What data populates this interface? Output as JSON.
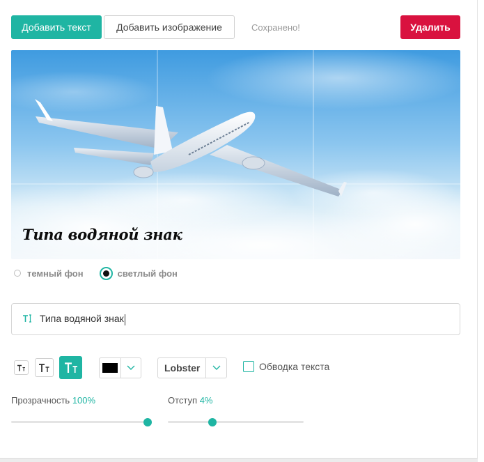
{
  "toolbar": {
    "add_text_label": "Добавить текст",
    "add_image_label": "Добавить изображение",
    "status": "Сохранено!",
    "delete_label": "Удалить"
  },
  "canvas": {
    "watermark_text": "Типа водяной знак"
  },
  "background_mode": {
    "options": [
      "темный фон",
      "светлый фон"
    ],
    "selected": "светлый фон"
  },
  "text_field": {
    "icon": "text-cursor-icon",
    "value": "Типа водяной знак"
  },
  "text_size": {
    "options": [
      "small",
      "medium",
      "large"
    ],
    "selected": "large"
  },
  "color_select": {
    "value": "#000000",
    "icon": "chevron-down-icon"
  },
  "font_select": {
    "value": "Lobster",
    "icon": "chevron-down-icon"
  },
  "outline": {
    "label": "Обводка текста",
    "checked": false
  },
  "opacity": {
    "label": "Прозрачность",
    "value": "100%",
    "fraction": 1.0
  },
  "offset": {
    "label": "Отступ",
    "value": "4%",
    "fraction": 0.4
  },
  "colors": {
    "accent": "#1fb5a3",
    "danger": "#d9123f"
  }
}
